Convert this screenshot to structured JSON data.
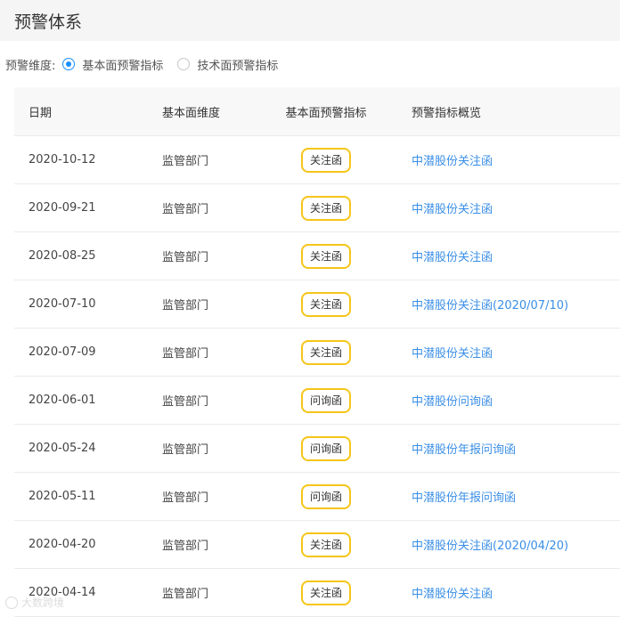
{
  "header": {
    "title": "预警体系"
  },
  "dimension": {
    "label": "预警维度:",
    "options": [
      {
        "label": "基本面预警指标",
        "checked": true
      },
      {
        "label": "技术面预警指标",
        "checked": false
      }
    ]
  },
  "table": {
    "columns": [
      "日期",
      "基本面维度",
      "基本面预警指标",
      "预警指标概览"
    ],
    "rows": [
      {
        "date": "2020-10-12",
        "dimension": "监管部门",
        "indicator": "关注函",
        "overview": "中潜股份关注函"
      },
      {
        "date": "2020-09-21",
        "dimension": "监管部门",
        "indicator": "关注函",
        "overview": "中潜股份关注函"
      },
      {
        "date": "2020-08-25",
        "dimension": "监管部门",
        "indicator": "关注函",
        "overview": "中潜股份关注函"
      },
      {
        "date": "2020-07-10",
        "dimension": "监管部门",
        "indicator": "关注函",
        "overview": "中潜股份关注函(2020/07/10)"
      },
      {
        "date": "2020-07-09",
        "dimension": "监管部门",
        "indicator": "关注函",
        "overview": "中潜股份关注函"
      },
      {
        "date": "2020-06-01",
        "dimension": "监管部门",
        "indicator": "问询函",
        "overview": "中潜股份问询函"
      },
      {
        "date": "2020-05-24",
        "dimension": "监管部门",
        "indicator": "问询函",
        "overview": "中潜股份年报问询函"
      },
      {
        "date": "2020-05-11",
        "dimension": "监管部门",
        "indicator": "问询函",
        "overview": "中潜股份年报问询函"
      },
      {
        "date": "2020-04-20",
        "dimension": "监管部门",
        "indicator": "关注函",
        "overview": "中潜股份关注函(2020/04/20)"
      },
      {
        "date": "2020-04-14",
        "dimension": "监管部门",
        "indicator": "关注函",
        "overview": "中潜股份关注函"
      }
    ]
  },
  "watermark": {
    "text": "大数跨境"
  },
  "colors": {
    "accent": "#1890ff",
    "link": "#3a8ee6",
    "badge_border": "#f5c518"
  }
}
